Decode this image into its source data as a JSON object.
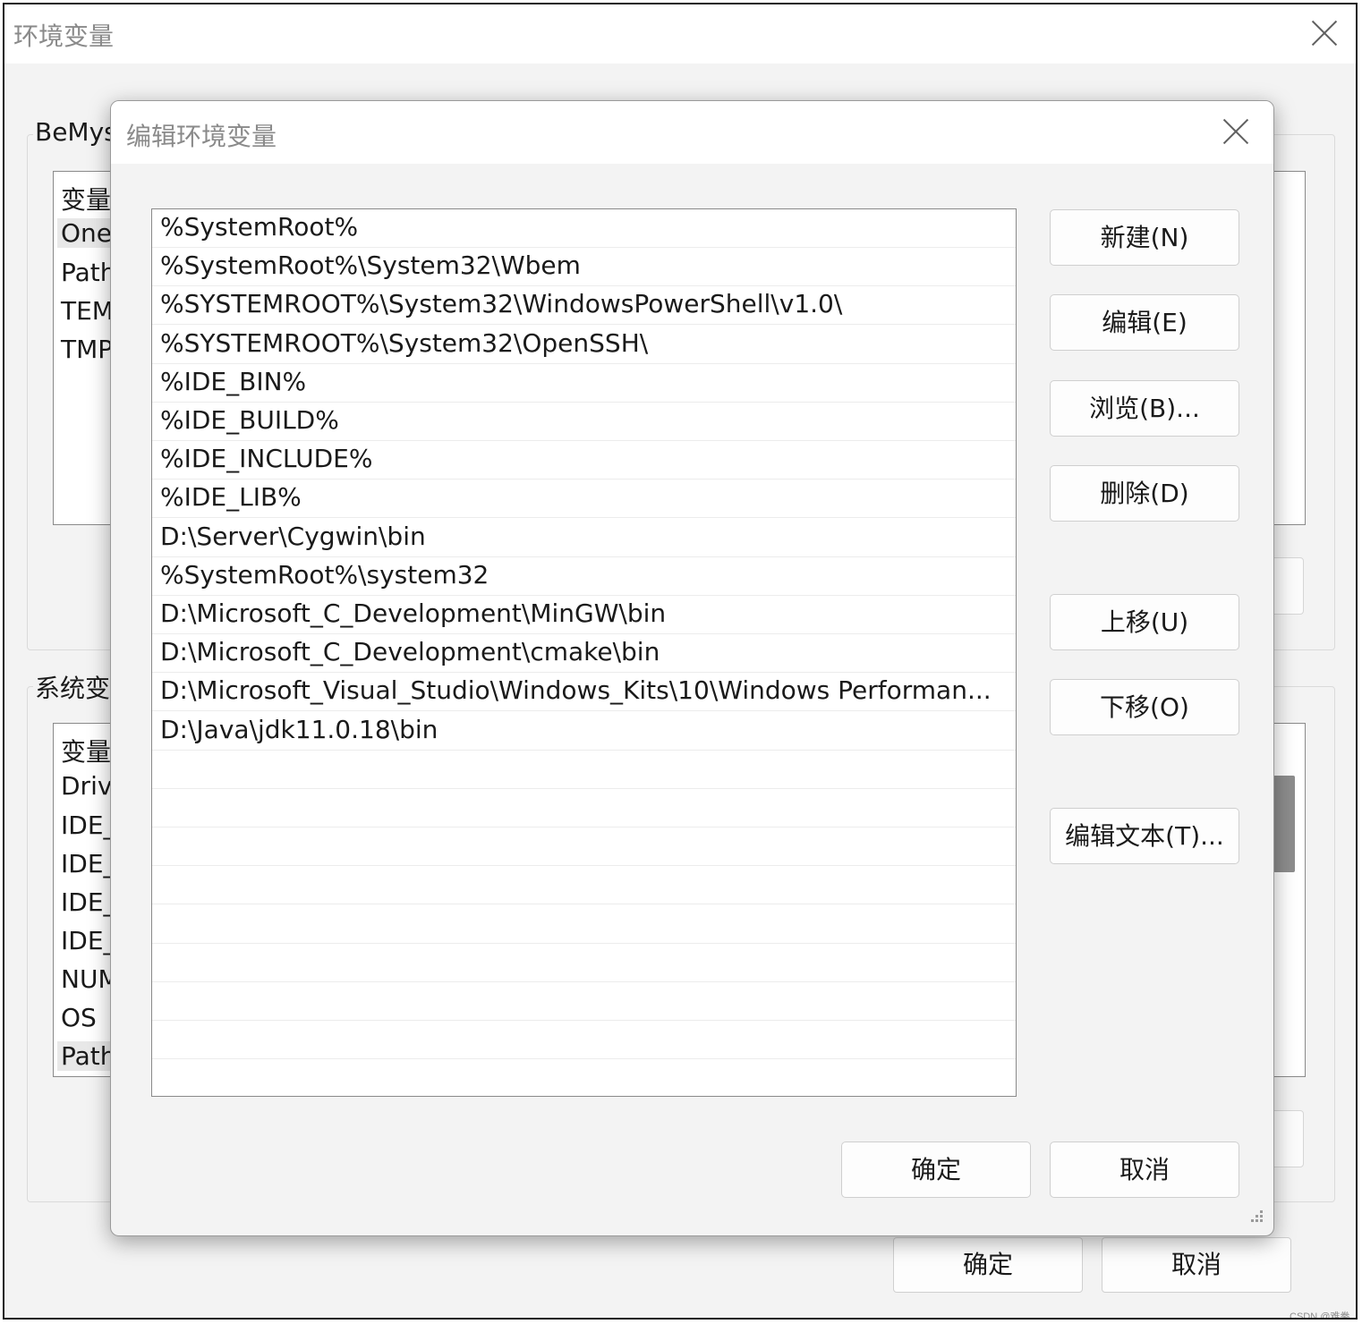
{
  "outer_dialog": {
    "title": "环境变量",
    "user_group_label": "BeMys",
    "user_list": {
      "header": "变量",
      "items": [
        "One",
        "Path",
        "TEM",
        "TMP"
      ]
    },
    "system_group_label": "系统变",
    "system_list": {
      "header": "变量",
      "items": [
        "Driv",
        "IDE_",
        "IDE_",
        "IDE_",
        "IDE_",
        "NUM",
        "OS",
        "Path"
      ]
    },
    "ok_label": "确定",
    "cancel_label": "取消"
  },
  "edit_dialog": {
    "title": "编辑环境变量",
    "paths": [
      "%SystemRoot%",
      "%SystemRoot%\\System32\\Wbem",
      "%SYSTEMROOT%\\System32\\WindowsPowerShell\\v1.0\\",
      "%SYSTEMROOT%\\System32\\OpenSSH\\",
      "%IDE_BIN%",
      "%IDE_BUILD%",
      "%IDE_INCLUDE%",
      "%IDE_LIB%",
      "D:\\Server\\Cygwin\\bin",
      "%SystemRoot%\\system32",
      "D:\\Microsoft_C_Development\\MinGW\\bin",
      "D:\\Microsoft_C_Development\\cmake\\bin",
      "D:\\Microsoft_Visual_Studio\\Windows_Kits\\10\\Windows Performan...",
      "D:\\Java\\jdk11.0.18\\bin"
    ],
    "buttons": {
      "new": "新建(N)",
      "edit": "编辑(E)",
      "browse": "浏览(B)...",
      "delete": "删除(D)",
      "move_up": "上移(U)",
      "move_down": "下移(O)",
      "edit_text": "编辑文本(T)..."
    },
    "ok_label": "确定",
    "cancel_label": "取消"
  },
  "watermark": "CSDN @难拳"
}
